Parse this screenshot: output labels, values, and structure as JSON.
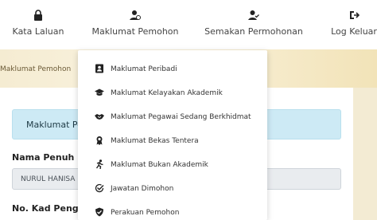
{
  "nav": {
    "items": [
      {
        "label": "Kata Laluan",
        "icon": "lock-icon"
      },
      {
        "label": "Maklumat Pemohon",
        "icon": "user-settings-icon"
      },
      {
        "label": "Semakan Permohonan",
        "icon": "user-check-icon"
      },
      {
        "label": "Log Keluar",
        "icon": "sign-out-icon"
      }
    ]
  },
  "breadcrumb": "Maklumat Pemohon",
  "alert_text": "Maklumat Pe",
  "form": {
    "nama_label": "Nama Penuh",
    "nama_value": "NURUL HANISA",
    "kad_label": "No. Kad Penger"
  },
  "dropdown": {
    "items": [
      {
        "label": "Maklumat Peribadi",
        "icon": "id-card-icon"
      },
      {
        "label": "Maklumat Kelayakan Akademik",
        "icon": "graduation-cap-icon"
      },
      {
        "label": "Maklumat Pegawai Sedang Berkhidmat",
        "icon": "handshake-icon"
      },
      {
        "label": "Maklumat Bekas Tentera",
        "icon": "medal-icon"
      },
      {
        "label": "Maklumat Bukan Akademik",
        "icon": "running-icon"
      },
      {
        "label": "Jawatan Dimohon",
        "icon": "check-circle-icon"
      },
      {
        "label": "Perakuan Pemohon",
        "icon": "shield-check-icon"
      }
    ]
  },
  "colors": {
    "nav_text": "#444444",
    "band": "#f5ecd2",
    "alert_bg": "#cdeaf5",
    "icon": "#222222"
  }
}
